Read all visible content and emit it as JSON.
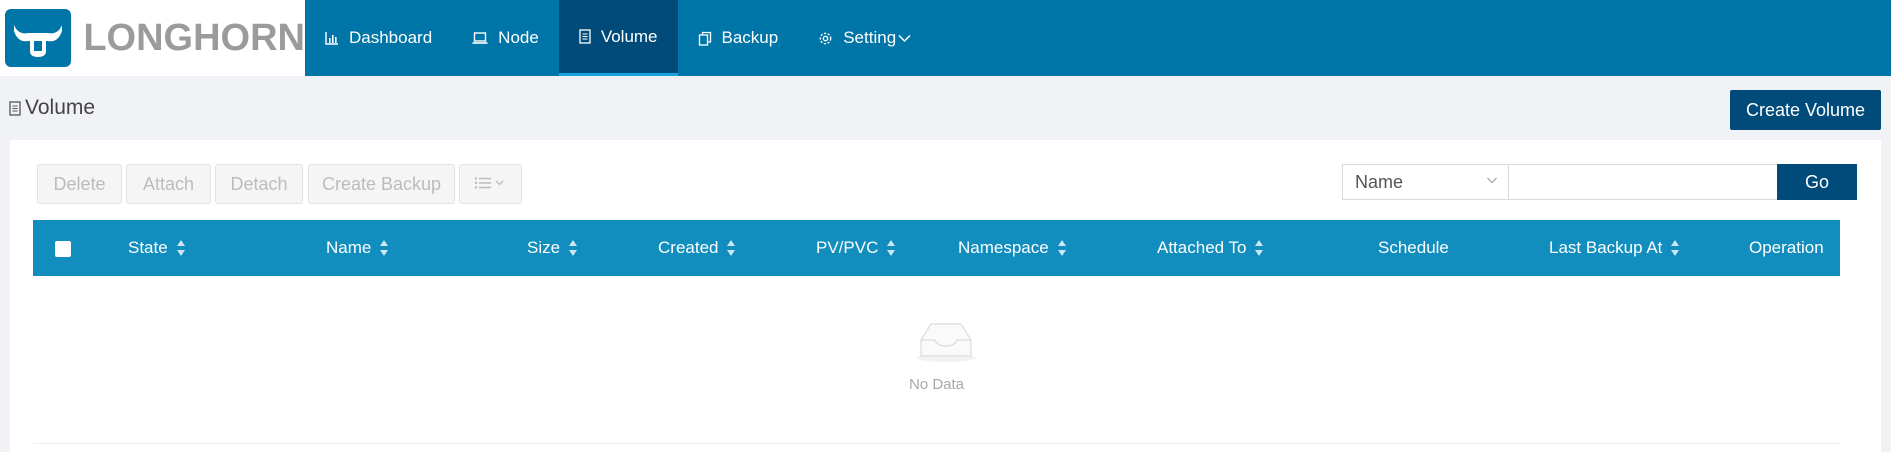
{
  "brand": {
    "name": "LONGHORN"
  },
  "nav": {
    "items": [
      {
        "label": "Dashboard",
        "icon": "bar-chart-icon"
      },
      {
        "label": "Node",
        "icon": "laptop-icon"
      },
      {
        "label": "Volume",
        "icon": "volume-doc-icon",
        "active": true
      },
      {
        "label": "Backup",
        "icon": "copy-icon"
      },
      {
        "label": "Setting",
        "icon": "gear-icon"
      }
    ]
  },
  "page": {
    "title": "Volume",
    "create_label": "Create Volume"
  },
  "toolbar": {
    "delete_label": "Delete",
    "attach_label": "Attach",
    "detach_label": "Detach",
    "create_backup_label": "Create Backup"
  },
  "search": {
    "field_selected": "Name",
    "value": "",
    "go_label": "Go"
  },
  "table": {
    "columns": [
      {
        "label": "State",
        "sortable": true
      },
      {
        "label": "Name",
        "sortable": true
      },
      {
        "label": "Size",
        "sortable": true
      },
      {
        "label": "Created",
        "sortable": true
      },
      {
        "label": "PV/PVC",
        "sortable": true
      },
      {
        "label": "Namespace",
        "sortable": true
      },
      {
        "label": "Attached To",
        "sortable": true
      },
      {
        "label": "Schedule",
        "sortable": false
      },
      {
        "label": "Last Backup At",
        "sortable": true
      },
      {
        "label": "Operation",
        "sortable": false
      }
    ],
    "rows": [],
    "empty_text": "No Data"
  },
  "colors": {
    "header_bg": "#0075a8",
    "nav_active": "#004b7a",
    "table_header": "#118dbe",
    "primary_button": "#004b7a"
  }
}
